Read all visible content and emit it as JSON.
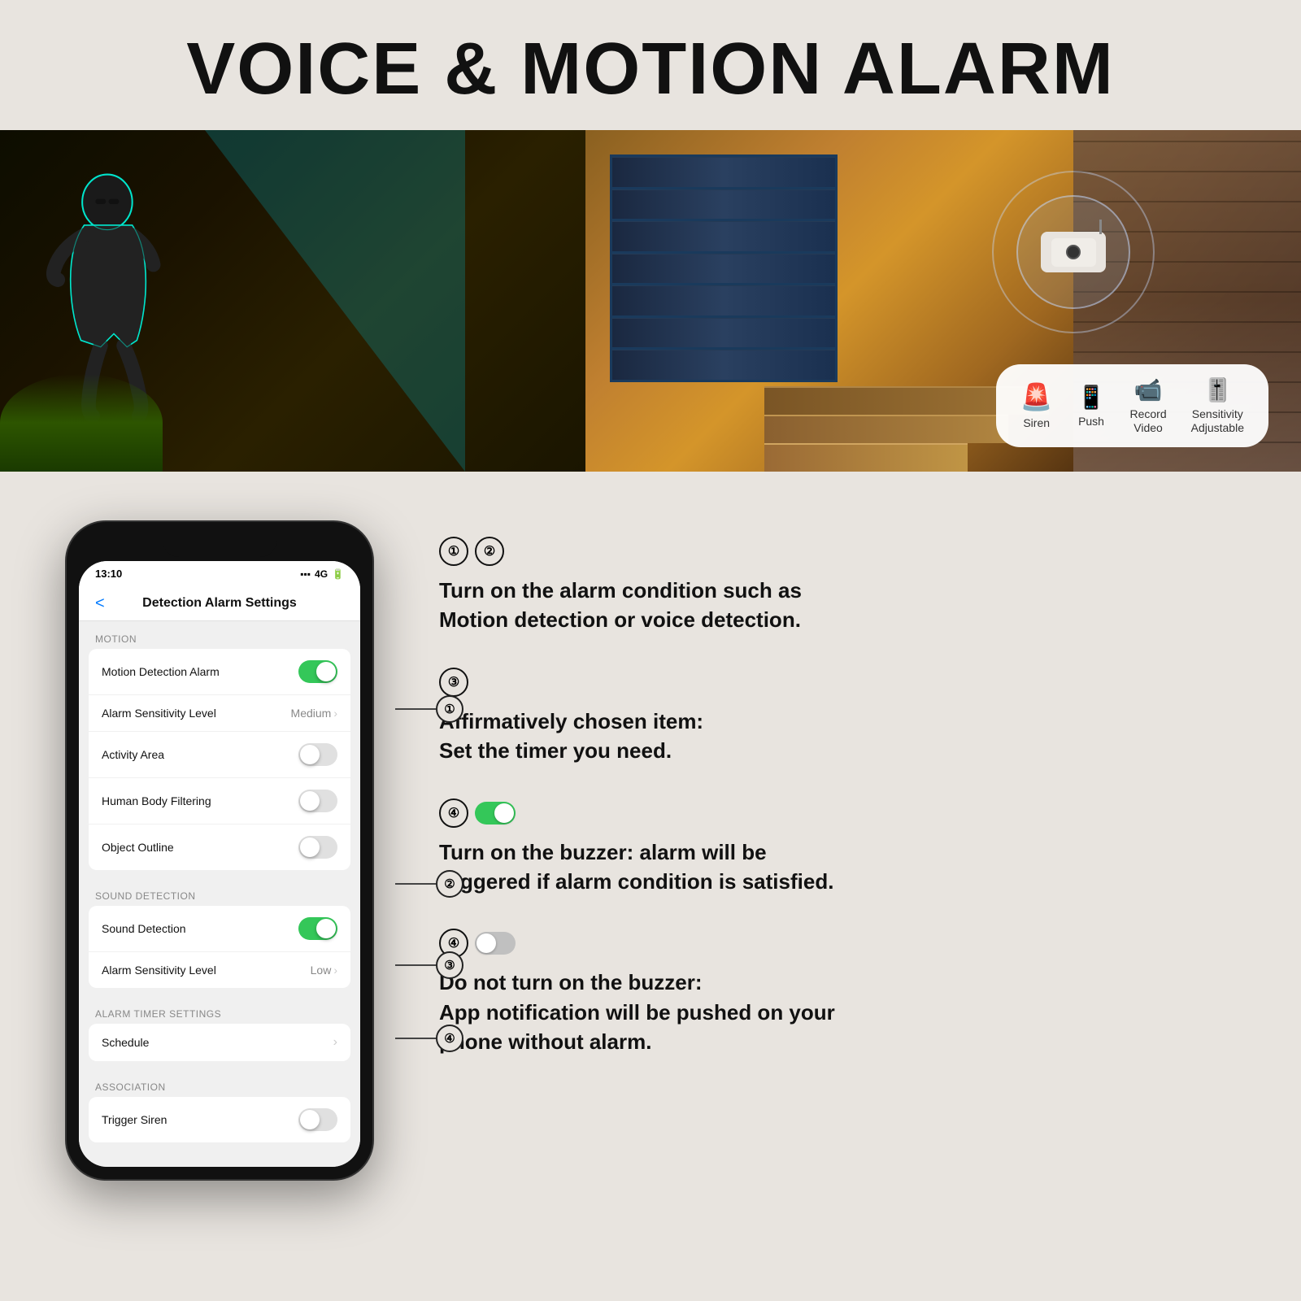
{
  "title": "VOICE & MOTION ALARM",
  "hero": {
    "feature_icons": [
      {
        "id": "siren",
        "symbol": "🚨",
        "label": "Siren"
      },
      {
        "id": "push",
        "symbol": "📱",
        "label": "Push"
      },
      {
        "id": "record",
        "symbol": "📹",
        "label": "Record\nVideo"
      },
      {
        "id": "sensitivity",
        "symbol": "🎚️",
        "label": "Sensitivity\nAdjustable"
      }
    ]
  },
  "phone": {
    "status_time": "13:10",
    "status_signal": "▪▪▪ 4G",
    "header_title": "Detection Alarm Settings",
    "back_label": "<",
    "sections": [
      {
        "label": "Motion",
        "rows": [
          {
            "id": "motion-detection-alarm",
            "label": "Motion Detection Alarm",
            "type": "toggle",
            "state": "on"
          },
          {
            "id": "alarm-sensitivity-motion",
            "label": "Alarm Sensitivity Level",
            "type": "value",
            "value": "Medium"
          },
          {
            "id": "activity-area",
            "label": "Activity Area",
            "type": "toggle",
            "state": "off"
          },
          {
            "id": "human-body-filtering",
            "label": "Human Body Filtering",
            "type": "toggle",
            "state": "off"
          },
          {
            "id": "object-outline",
            "label": "Object Outline",
            "type": "toggle",
            "state": "off"
          }
        ]
      },
      {
        "label": "Sound Detection",
        "rows": [
          {
            "id": "sound-detection",
            "label": "Sound Detection",
            "type": "toggle",
            "state": "on"
          },
          {
            "id": "alarm-sensitivity-sound",
            "label": "Alarm Sensitivity Level",
            "type": "value",
            "value": "Low"
          }
        ]
      },
      {
        "label": "Alarm Timer Settings",
        "rows": [
          {
            "id": "schedule",
            "label": "Schedule",
            "type": "arrow"
          }
        ]
      },
      {
        "label": "Association",
        "rows": [
          {
            "id": "trigger-siren",
            "label": "Trigger Siren",
            "type": "toggle",
            "state": "off"
          }
        ]
      }
    ],
    "callouts": [
      {
        "id": "callout-1",
        "number": "①"
      },
      {
        "id": "callout-2",
        "number": "②"
      },
      {
        "id": "callout-3",
        "number": "③"
      },
      {
        "id": "callout-4",
        "number": "④"
      }
    ]
  },
  "instructions": [
    {
      "id": "instruction-1-2",
      "numbers": [
        "①",
        "②"
      ],
      "text": "Turn on the alarm condition such as Motion detection or voice detection."
    },
    {
      "id": "instruction-3",
      "numbers": [
        "③"
      ],
      "text": "Affirmatively chosen item:\nSet the timer you need."
    },
    {
      "id": "instruction-4-on",
      "numbers": [
        "④"
      ],
      "toggle_state": "on",
      "text": "Turn on the buzzer: alarm will be triggered if alarm condition is satisfied."
    },
    {
      "id": "instruction-4-off",
      "numbers": [
        "④"
      ],
      "toggle_state": "off",
      "text": "Do not turn on the buzzer:\nApp notification will be pushed on your phone without alarm."
    }
  ]
}
